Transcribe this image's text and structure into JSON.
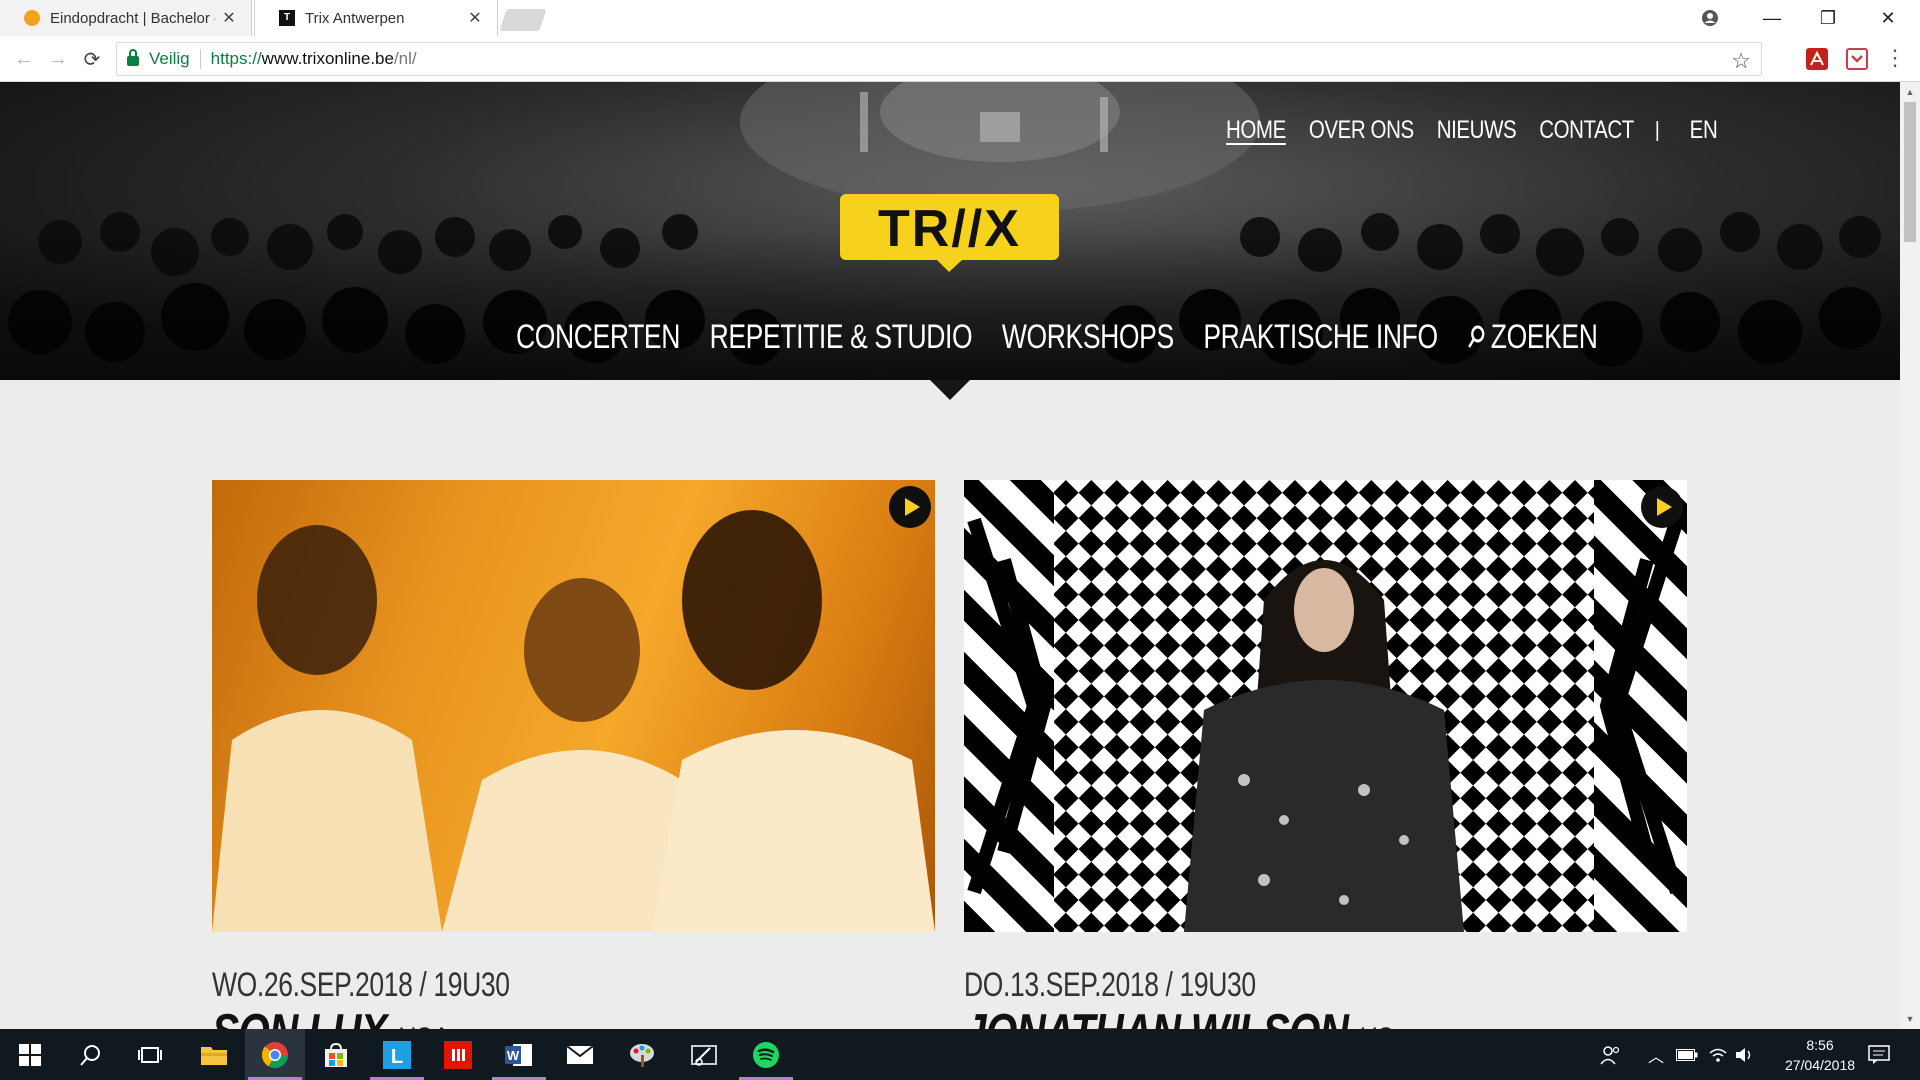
{
  "browser": {
    "tabs": [
      {
        "title": "Eindopdracht | Bachelor o",
        "active": false,
        "favicon": "orange-circle-icon"
      },
      {
        "title": "Trix Antwerpen",
        "active": true,
        "favicon": "trix-favicon"
      }
    ],
    "security_label": "Veilig",
    "url": {
      "scheme": "https://",
      "host": "www.trixonline.be",
      "path": "/nl/"
    }
  },
  "site": {
    "top_nav": [
      {
        "label": "HOME",
        "active": true
      },
      {
        "label": "OVER ONS"
      },
      {
        "label": "NIEUWS"
      },
      {
        "label": "CONTACT"
      }
    ],
    "lang": "EN",
    "logo_text": "TR//X",
    "main_nav": [
      {
        "label": "CONCERTEN"
      },
      {
        "label": "REPETITIE & STUDIO"
      },
      {
        "label": "WORKSHOPS"
      },
      {
        "label": "PRAKTISCHE INFO"
      },
      {
        "label": "ZOEKEN"
      }
    ],
    "events": [
      {
        "date": "WO.26.SEP.2018 / 19U30",
        "artist": "SON LUX",
        "country": "USA"
      },
      {
        "date": "DO.13.SEP.2018 / 19U30",
        "artist": "JONATHAN WILSON",
        "country": "US"
      }
    ],
    "colors": {
      "brand_yellow": "#f7d21d",
      "dark": "#161616",
      "page_bg": "#ececec"
    }
  },
  "taskbar": {
    "time": "8:56",
    "date": "27/04/2018"
  }
}
